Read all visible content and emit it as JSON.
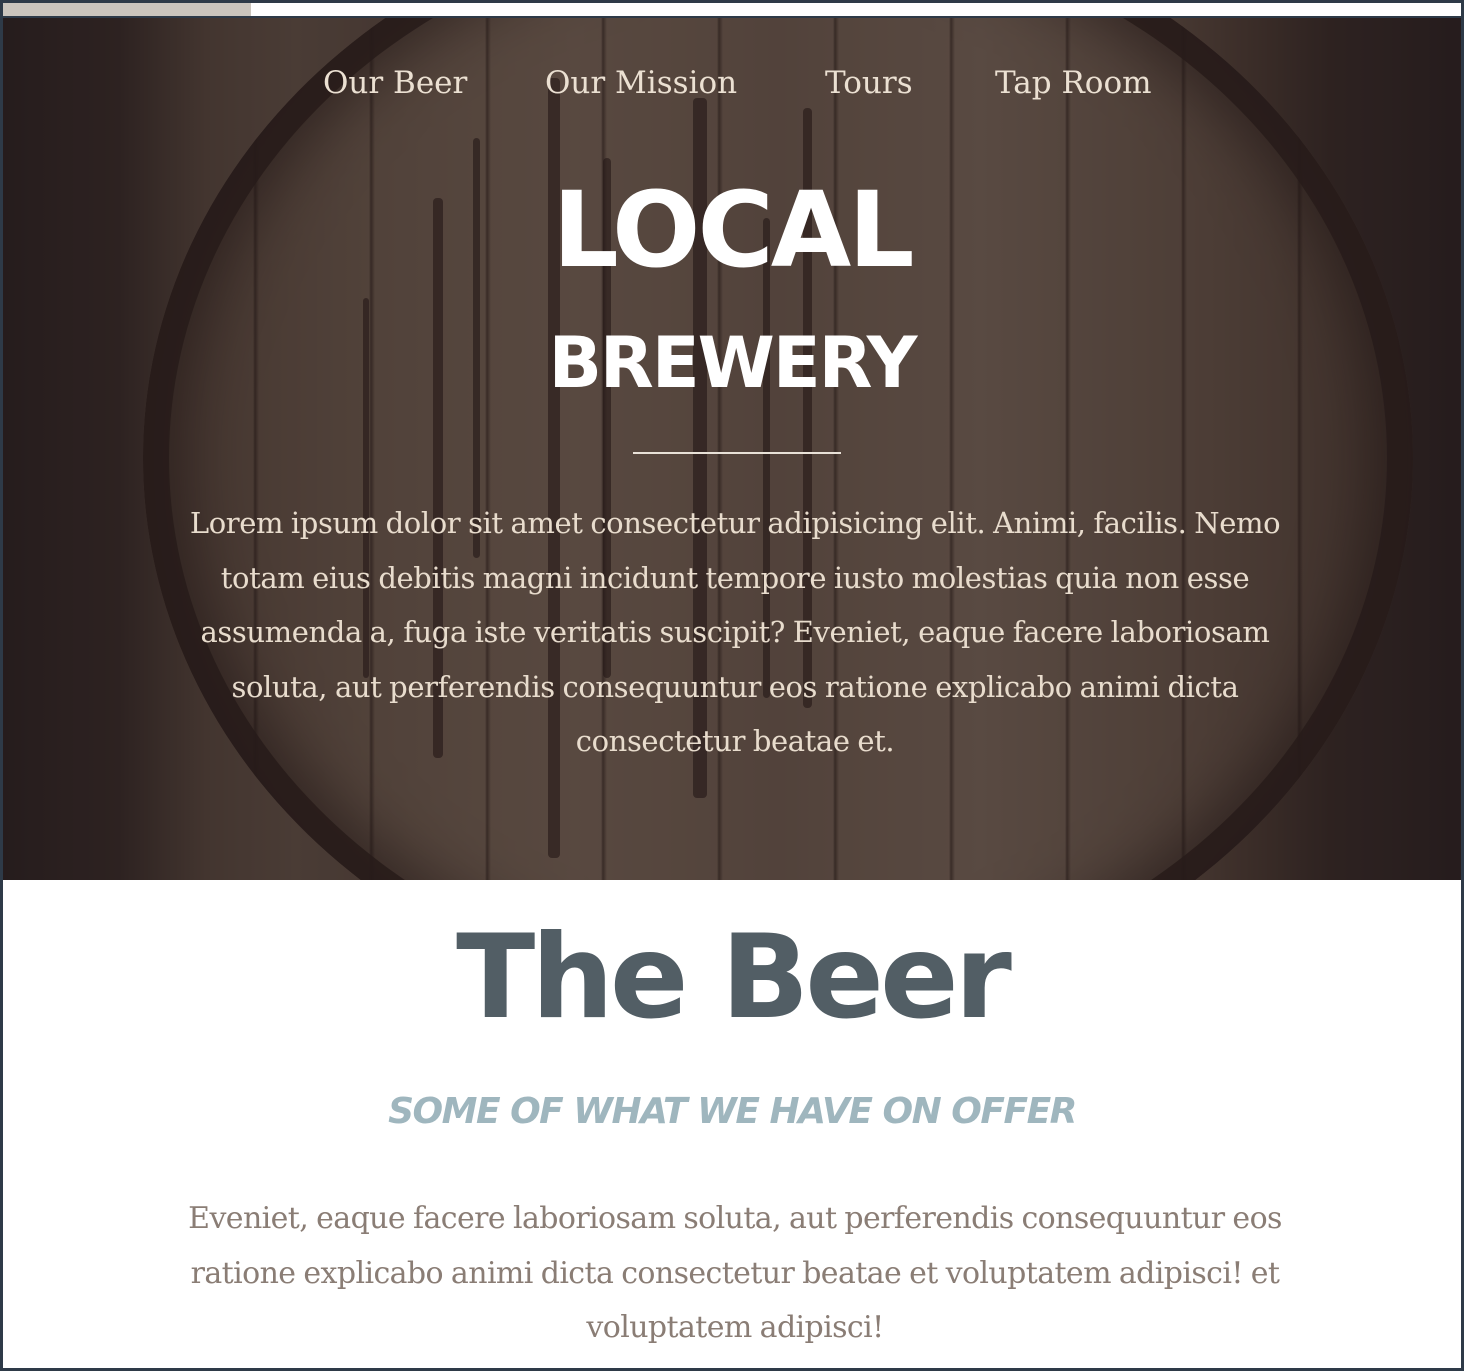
{
  "progress": {
    "value_fraction": 0.17,
    "fill_color": "#cbc5bd"
  },
  "nav": {
    "items": [
      {
        "label": "Our Beer"
      },
      {
        "label": "Our Mission"
      },
      {
        "label": "Tours"
      },
      {
        "label": "Tap Room"
      }
    ]
  },
  "hero": {
    "title_line1": "LOCAL",
    "title_line2": "BREWERY",
    "text": "Lorem ipsum dolor sit amet consectetur adipisicing elit. Animi, facilis. Nemo totam eius debitis magni incidunt tempore iusto molestias quia non esse assumenda a, fuga iste veritatis suscipit? Eveniet, eaque facere laboriosam soluta, aut perferendis consequuntur eos ratione explicabo animi dicta consectetur beatae et."
  },
  "beer": {
    "title": "The Beer",
    "subtitle": "SOME OF WHAT WE HAVE ON OFFER",
    "text": "Eveniet, eaque facere laboriosam soluta, aut perferendis consequuntur eos ratione explicabo animi dicta consectetur beatae et voluptatem adipisci! et voluptatem adipisci!"
  },
  "colors": {
    "frame_border": "#2e3a48",
    "nav_text": "#ebe0d2",
    "title_text": "#ffffff",
    "beer_title": "#525e65",
    "beer_subtitle": "#9fb6be",
    "beer_text": "#8a7d75"
  }
}
